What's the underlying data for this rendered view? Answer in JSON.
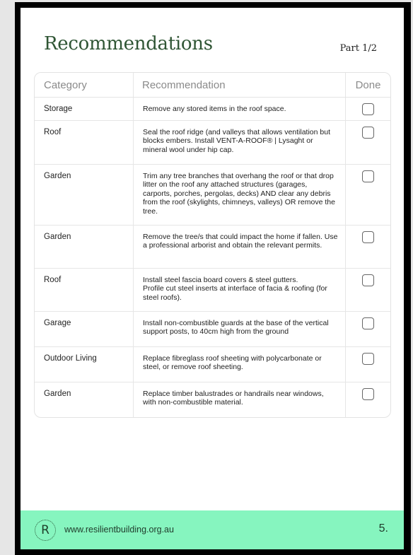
{
  "header": {
    "title": "Recommendations",
    "part": "Part 1/2"
  },
  "table": {
    "headers": {
      "category": "Category",
      "recommendation": "Recommendation",
      "done": "Done"
    },
    "rows": [
      {
        "category": "Storage",
        "recommendation": "Remove any stored items in the roof space."
      },
      {
        "category": "Roof",
        "recommendation": "Seal the roof ridge (and valleys that allows ventilation but blocks embers. Install VENT-A-ROOF® | Lysaght or mineral wool under hip cap."
      },
      {
        "category": "Garden",
        "recommendation": "Trim any tree branches that overhang the roof or that drop litter on the roof any attached structures (garages, carports, porches, pergolas, decks) AND clear any debris from the roof (skylights, chimneys, valleys) OR remove the tree."
      },
      {
        "category": "Garden",
        "recommendation": "Remove the tree/s that could impact the home if fallen. Use a professional arborist and obtain the relevant permits."
      },
      {
        "category": "Roof",
        "recommendation": "Install steel fascia board covers & steel gutters.\nProfile cut steel inserts at interface of facia & roofing (for steel roofs)."
      },
      {
        "category": "Garage",
        "recommendation": "Install non-combustible guards at the base of the vertical support posts, to 40cm high from the ground"
      },
      {
        "category": "Outdoor Living",
        "recommendation": "Replace fibreglass roof sheeting with polycarbonate or steel, or remove roof sheeting."
      },
      {
        "category": "Garden",
        "recommendation": "Replace timber balustrades or handrails near windows, with non-combustible material."
      }
    ]
  },
  "footer": {
    "logo_letter": "R",
    "url": "www.resilientbuilding.org.au",
    "page_number": "5."
  }
}
